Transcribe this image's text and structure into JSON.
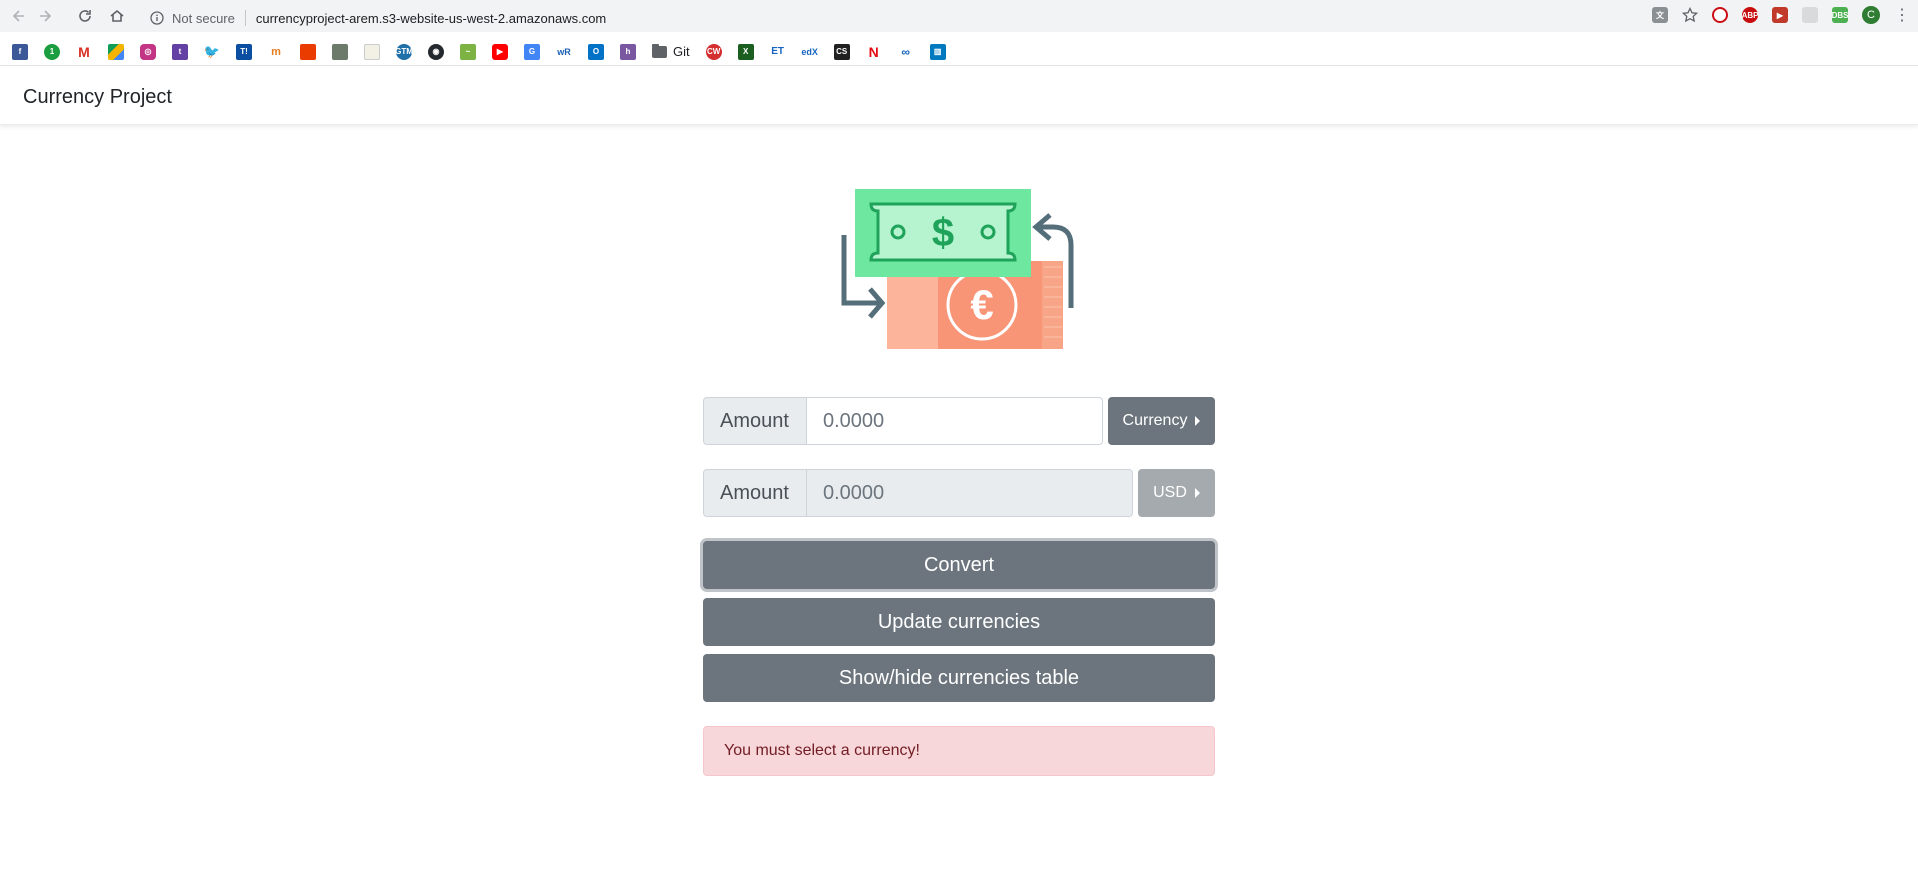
{
  "browser": {
    "security_text": "Not secure",
    "url": "currencyproject-arem.s3-website-us-west-2.amazonaws.com",
    "profile_initial": "C",
    "bookmarks_folder_label": "Git"
  },
  "navbar": {
    "brand": "Currency Project"
  },
  "converter": {
    "from": {
      "label": "Amount",
      "placeholder": "0.0000",
      "currency_button": "Currency"
    },
    "to": {
      "label": "Amount",
      "placeholder": "0.0000",
      "currency_button": "USD"
    },
    "convert_button": "Convert",
    "update_button": "Update currencies",
    "toggle_table_button": "Show/hide currencies table"
  },
  "alert": {
    "message": "You must select a currency!"
  },
  "colors": {
    "secondary": "#6c757d",
    "alert_bg": "#f8d7da",
    "alert_text": "#721c24",
    "banknote_green": "#6ee7a0",
    "banknote_orange": "#fb9b7a"
  }
}
